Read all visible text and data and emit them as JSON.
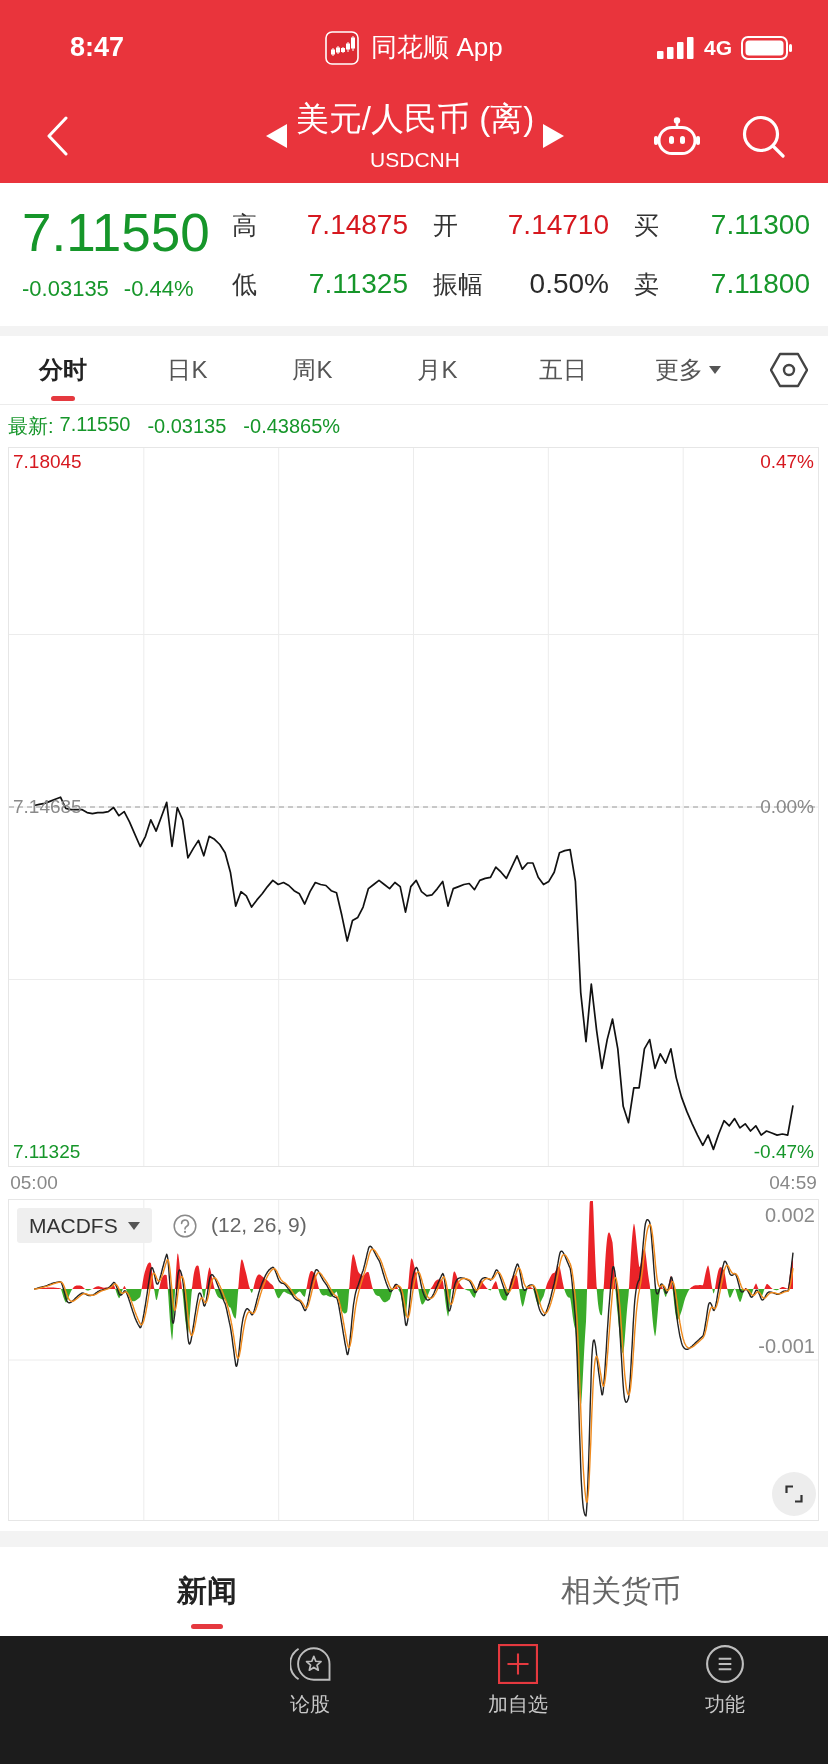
{
  "status_bar": {
    "time": "8:47",
    "app_name": "同花顺 App",
    "network": "4G"
  },
  "header": {
    "title": "美元/人民币 (离)",
    "code": "USDCNH"
  },
  "quote": {
    "price": "7.11550",
    "change": "-0.03135",
    "change_percent": "-0.44%",
    "color": "#16962a",
    "stats": [
      {
        "label": "高",
        "value": "7.14875",
        "color": "#d6181f"
      },
      {
        "label": "开",
        "value": "7.14710",
        "color": "#d6181f"
      },
      {
        "label": "买",
        "value": "7.11300",
        "color": "#16962a"
      },
      {
        "label": "低",
        "value": "7.11325",
        "color": "#16962a"
      },
      {
        "label": "振幅",
        "value": "0.50%",
        "color": "#2a2a2a"
      },
      {
        "label": "卖",
        "value": "7.11800",
        "color": "#16962a"
      }
    ]
  },
  "period_tabs": [
    {
      "label": "分时",
      "selected": true,
      "kind": "tab"
    },
    {
      "label": "日K",
      "selected": false,
      "kind": "tab"
    },
    {
      "label": "周K",
      "selected": false,
      "kind": "tab"
    },
    {
      "label": "月K",
      "selected": false,
      "kind": "tab"
    },
    {
      "label": "五日",
      "selected": false,
      "kind": "tab"
    },
    {
      "label": "更多",
      "selected": false,
      "kind": "menu"
    }
  ],
  "latest": {
    "label": "最新:",
    "price": "7.11550",
    "change": "-0.03135",
    "change_percent": "-0.43865%",
    "color": "#16962a"
  },
  "price_chart": {
    "percent_labels": [
      "0.47%",
      "0.00%",
      "-0.47%"
    ],
    "chart_data": {
      "type": "line",
      "categories": [
        "05:00",
        null,
        null,
        null,
        null,
        null,
        null,
        null,
        null,
        null,
        null,
        null,
        null,
        null,
        null,
        null,
        null,
        null,
        null,
        null,
        null,
        null,
        null,
        null,
        null,
        null,
        null,
        null,
        null,
        null,
        null,
        null,
        null,
        null,
        null,
        null,
        null,
        null,
        null,
        null,
        null,
        null,
        null,
        null,
        null,
        null,
        null,
        null,
        null,
        null,
        null,
        null,
        null,
        null,
        null,
        null,
        null,
        null,
        null,
        null,
        null,
        null,
        null,
        null,
        null,
        null,
        null,
        null,
        null,
        null,
        null,
        null,
        null,
        null,
        null,
        null,
        null,
        null,
        null,
        null,
        null,
        null,
        null,
        null,
        null,
        null,
        null,
        null,
        null,
        null,
        null,
        null,
        null,
        null,
        null,
        null,
        null,
        null,
        null,
        null,
        null,
        null,
        null,
        null,
        null,
        null,
        null,
        null,
        null,
        null,
        null,
        null,
        null,
        null,
        null,
        null,
        null,
        null,
        null,
        null,
        null,
        null,
        null,
        null,
        null,
        null,
        null,
        null,
        null,
        null,
        null,
        null,
        null,
        null,
        null,
        null,
        null,
        null,
        null,
        null,
        null,
        null,
        null,
        "04:59"
      ],
      "series": [
        {
          "values": [
            7.147,
            7.1471,
            7.1472,
            7.1474,
            7.1476,
            7.1478,
            7.1467,
            7.1466,
            7.1466,
            7.1466,
            7.1463,
            7.1462,
            7.1463,
            7.1463,
            7.1464,
            7.1468,
            7.146,
            7.1464,
            7.1454,
            7.1442,
            7.143,
            7.144,
            7.1456,
            7.1445,
            7.1459,
            7.1473,
            7.143,
            7.1468,
            7.1456,
            7.1419,
            7.1428,
            7.1436,
            7.1421,
            7.144,
            7.1437,
            7.1432,
            7.1424,
            7.1405,
            7.1372,
            7.1386,
            7.1382,
            7.1371,
            7.1378,
            7.1384,
            7.1391,
            7.1397,
            7.1393,
            7.1395,
            7.1392,
            7.1387,
            7.1384,
            7.1374,
            7.1386,
            7.1395,
            7.1393,
            7.1392,
            7.1387,
            7.1385,
            7.1363,
            7.1338,
            7.1358,
            7.1361,
            7.1371,
            7.1389,
            7.1393,
            7.1397,
            7.1393,
            7.1389,
            7.1395,
            7.1391,
            7.1366,
            7.1391,
            7.1397,
            7.1386,
            7.1382,
            7.1383,
            7.1389,
            7.1396,
            7.1372,
            7.1389,
            7.1391,
            7.1393,
            7.1394,
            7.1388,
            7.1397,
            7.1399,
            7.14,
            7.141,
            7.1405,
            7.1399,
            7.141,
            7.1421,
            7.1408,
            7.1414,
            7.1414,
            7.14,
            7.1393,
            7.1396,
            7.1405,
            7.1424,
            7.1426,
            7.1427,
            7.1396,
            7.1288,
            7.124,
            7.1296,
            7.1251,
            7.1214,
            7.1242,
            7.1262,
            7.1233,
            7.1177,
            7.1161,
            7.1195,
            7.1195,
            7.1233,
            7.1242,
            7.1214,
            7.1228,
            7.1219,
            7.1233,
            7.1205,
            7.1186,
            7.1172,
            7.116,
            7.1149,
            7.1139,
            7.1149,
            7.1135,
            7.115,
            7.1163,
            7.1158,
            7.1165,
            7.1156,
            7.116,
            7.1153,
            7.1158,
            7.1149,
            7.1153,
            7.1151,
            7.1149,
            7.115,
            7.1149,
            7.1178
          ]
        }
      ],
      "ylim": [
        7.11325,
        7.18045
      ],
      "yticks": [
        {
          "value": 7.18045,
          "label": "7.18045"
        },
        {
          "value": 7.14685,
          "label": "7.14685"
        },
        {
          "value": 7.11325,
          "label": "7.11325"
        }
      ],
      "ref_lines": [
        {
          "axis": "y",
          "value": 7.14685
        }
      ]
    }
  },
  "macd": {
    "indicator": "MACDFS",
    "params": "(12, 26, 9)",
    "axis_labels": [
      "0.002",
      "-0.001"
    ]
  },
  "news_tabs": [
    {
      "label": "新闻",
      "selected": true
    },
    {
      "label": "相关货币",
      "selected": false
    }
  ],
  "bottom_bar": [
    {
      "label": "论股",
      "kind": "discuss"
    },
    {
      "label": "加自选",
      "kind": "add"
    },
    {
      "label": "功能",
      "kind": "menu"
    }
  ]
}
